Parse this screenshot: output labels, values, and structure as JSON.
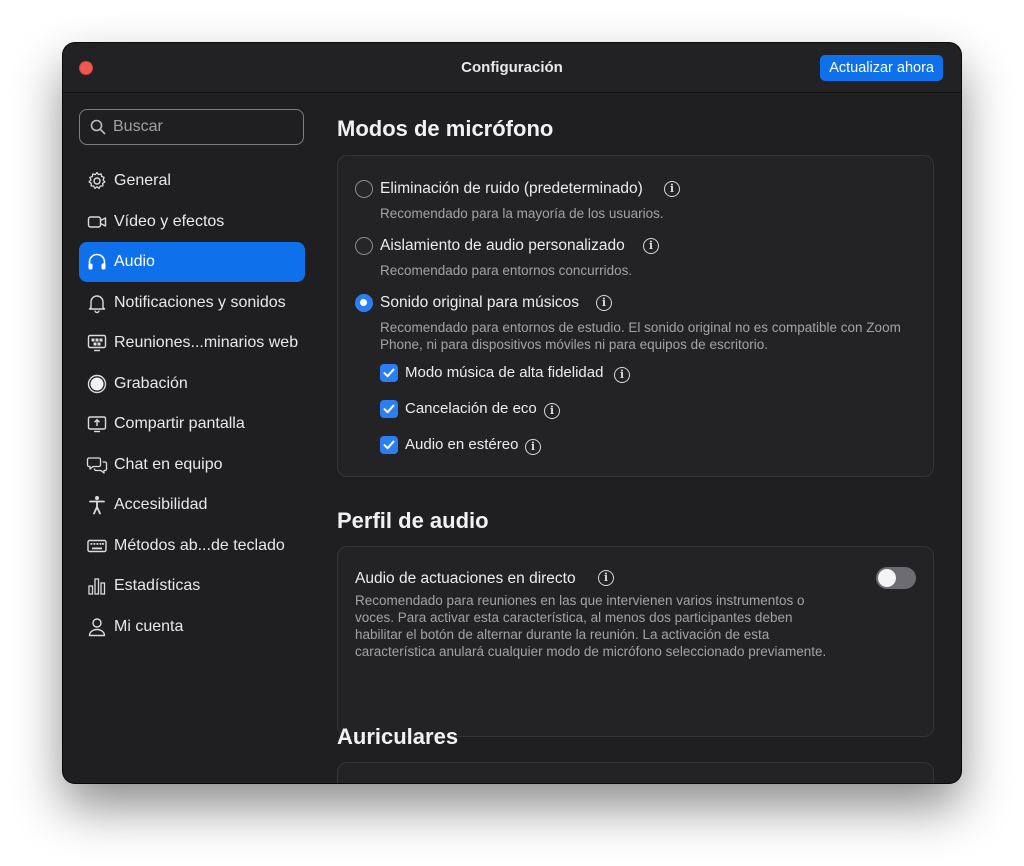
{
  "window": {
    "title": "Configuración",
    "update_button": "Actualizar ahora"
  },
  "sidebar": {
    "search_placeholder": "Buscar",
    "items": [
      {
        "label": "General",
        "icon": "gear-icon"
      },
      {
        "label": "Vídeo y efectos",
        "icon": "video-camera-icon"
      },
      {
        "label": "Audio",
        "icon": "headphones-icon",
        "active": true
      },
      {
        "label": "Notificaciones y sonidos",
        "icon": "bell-icon"
      },
      {
        "label": "Reuniones...minarios web",
        "icon": "webinar-screen-icon"
      },
      {
        "label": "Grabación",
        "icon": "record-icon"
      },
      {
        "label": "Compartir pantalla",
        "icon": "share-screen-icon"
      },
      {
        "label": "Chat en equipo",
        "icon": "chat-bubbles-icon"
      },
      {
        "label": "Accesibilidad",
        "icon": "accessibility-icon"
      },
      {
        "label": "Métodos ab...de teclado",
        "icon": "keyboard-icon"
      },
      {
        "label": "Estadísticas",
        "icon": "bar-chart-icon"
      },
      {
        "label": "Mi cuenta",
        "icon": "person-icon"
      }
    ]
  },
  "mic_modes": {
    "heading": "Modos de micrófono",
    "options": [
      {
        "title": "Eliminación de ruido (predeterminado)",
        "desc": "Recomendado para la mayoría de los usuarios.",
        "selected": false
      },
      {
        "title": "Aislamiento de audio personalizado",
        "desc": "Recomendado para entornos concurridos.",
        "selected": false
      },
      {
        "title": "Sonido original para músicos",
        "desc": "Recomendado para entornos de estudio. El sonido original no es compatible con Zoom Phone, ni para dispositivos móviles ni para equipos de escritorio.",
        "selected": true
      }
    ],
    "checkboxes": [
      {
        "label": "Modo música de alta fidelidad",
        "checked": true
      },
      {
        "label": "Cancelación de eco",
        "checked": true
      },
      {
        "label": "Audio en estéreo",
        "checked": true
      }
    ]
  },
  "audio_profile": {
    "heading": "Perfil de audio",
    "title": "Audio de actuaciones en directo",
    "desc": "Recomendado para reuniones en las que intervienen varios instrumentos o voces. Para activar esta característica, al menos dos participantes deben habilitar el botón de alternar durante la reunión. La activación de esta característica anulará cualquier modo de micrófono seleccionado previamente.",
    "toggle_on": false
  },
  "headphones": {
    "heading": "Auriculares"
  },
  "colors": {
    "accent": "#0e71eb",
    "window_bg": "#1f1f21",
    "close_button": "#ee5a52"
  }
}
